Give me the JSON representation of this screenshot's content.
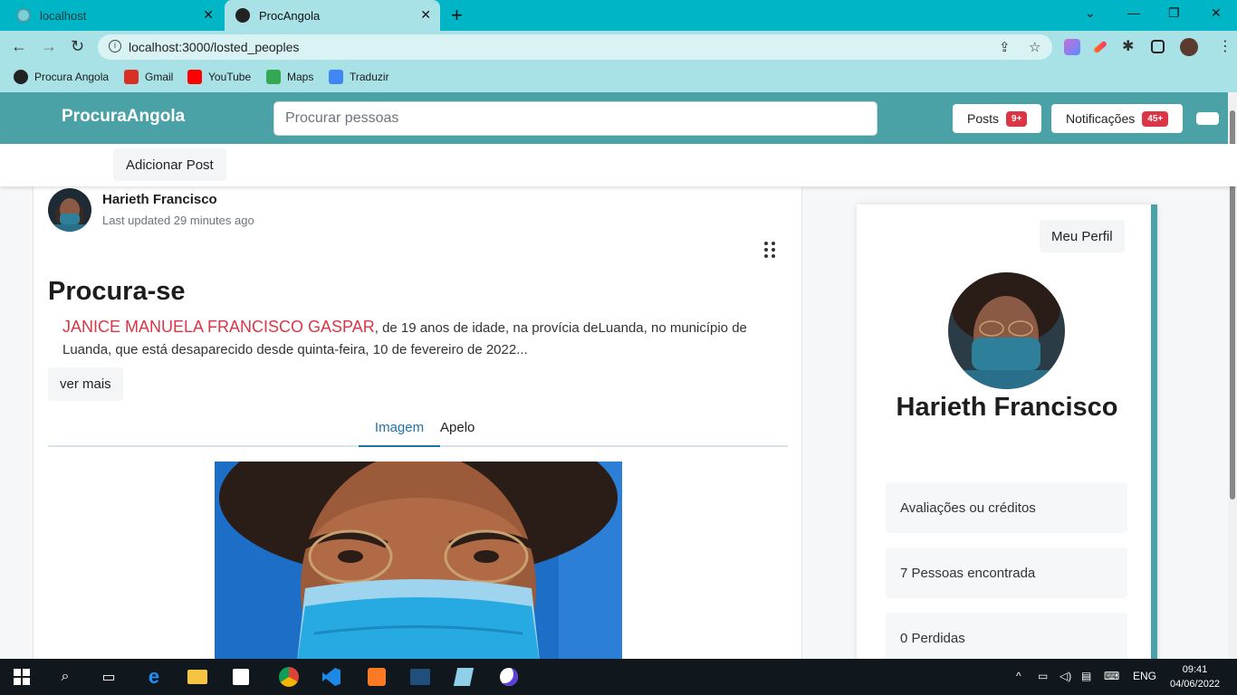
{
  "browser": {
    "tabs": [
      {
        "title": "localhost",
        "active": false
      },
      {
        "title": "ProcAngola",
        "active": true
      }
    ],
    "new_tab_icon": "+",
    "url": "localhost:3000/losted_peoples",
    "bookmarks": [
      {
        "label": "Procura Angola",
        "color": "#222222"
      },
      {
        "label": "Gmail",
        "color": "#d93025"
      },
      {
        "label": "YouTube",
        "color": "#ff0000"
      },
      {
        "label": "Maps",
        "color": "#34a853"
      },
      {
        "label": "Traduzir",
        "color": "#4285f4"
      }
    ]
  },
  "app": {
    "brand": "ProcuraAngola",
    "search_placeholder": "Procurar pessoas",
    "posts_label": "Posts",
    "posts_badge": "9+",
    "notifications_label": "Notificações",
    "notifications_badge": "45+",
    "add_post_label": "Adicionar Post",
    "accent_color": "#4aa2a7",
    "badge_color": "#dc3545"
  },
  "post": {
    "author": "Harieth Francisco",
    "updated": "Last updated 29 minutes ago",
    "title": "Procura-se",
    "missing_name": "JANICE MANUELA FRANCISCO GASPAR",
    "description": ", de 19 anos de idade, na provícia deLuanda, no município de Luanda, que está desaparecido desde quinta-feira, 10 de fevereiro de 2022...",
    "more_label": "ver mais",
    "tabs": [
      "Imagem",
      "Apelo"
    ]
  },
  "profile": {
    "my_profile_label": "Meu Perfil",
    "name": "Harieth Francisco",
    "stats": [
      "Avaliações ou créditos",
      "7 Pessoas encontrada",
      "0 Perdidas"
    ]
  },
  "taskbar": {
    "language": "ENG",
    "time": "09:41",
    "date": "04/06/2022"
  }
}
